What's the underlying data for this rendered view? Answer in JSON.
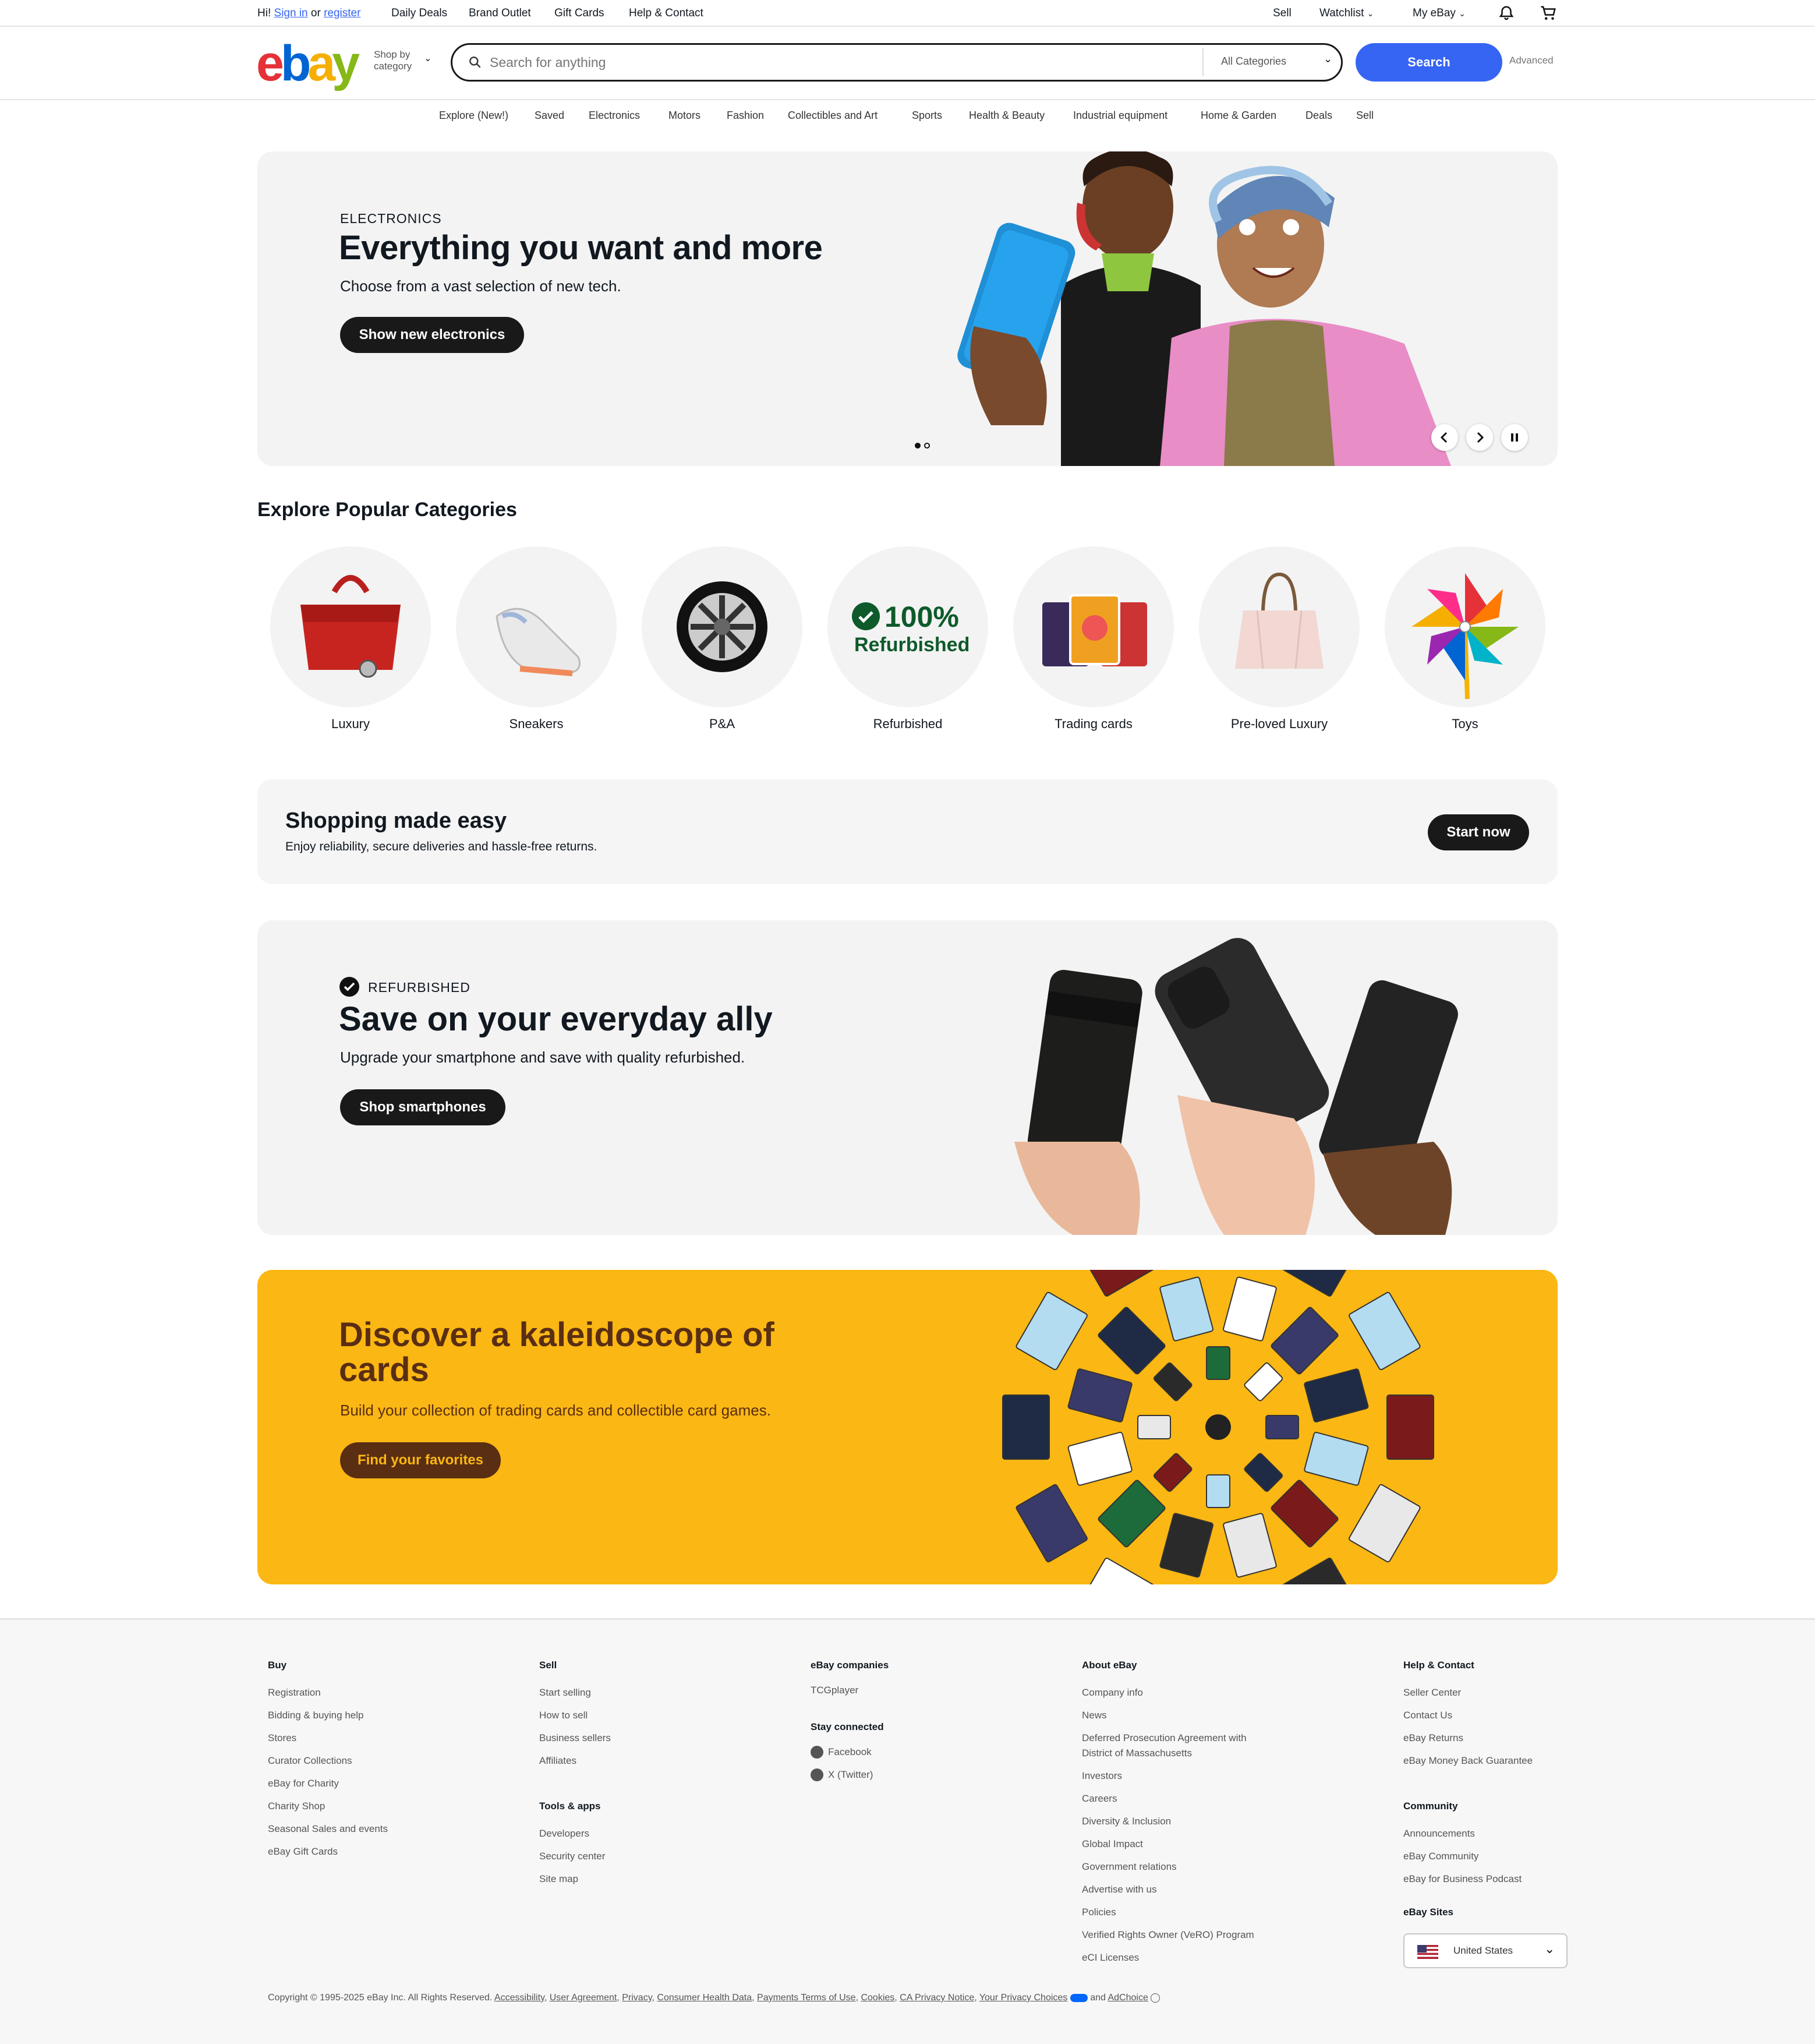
{
  "topbar": {
    "greeting": "Hi!",
    "sign_in": "Sign in",
    "or": "or",
    "register": "register",
    "links": [
      "Daily Deals",
      "Brand Outlet",
      "Gift Cards",
      "Help & Contact"
    ],
    "sell": "Sell",
    "watchlist": "Watchlist",
    "my_ebay": "My eBay"
  },
  "header": {
    "logo_letters": [
      "e",
      "b",
      "a",
      "y"
    ],
    "logo_colors": [
      "#e53238",
      "#0064d2",
      "#f5af02",
      "#86b817"
    ],
    "shop_by_1": "Shop by",
    "shop_by_2": "category",
    "search_placeholder": "Search for anything",
    "category_select": "All Categories",
    "search_button": "Search",
    "advanced": "Advanced",
    "accent": "#3665f3"
  },
  "nav": [
    "Explore (New!)",
    "Saved",
    "Electronics",
    "Motors",
    "Fashion",
    "Collectibles and Art",
    "Sports",
    "Health & Beauty",
    "Industrial equipment",
    "Home & Garden",
    "Deals",
    "Sell"
  ],
  "hero": {
    "eyebrow": "ELECTRONICS",
    "title": "Everything you want and more",
    "subtitle": "Choose from a vast selection of new tech.",
    "cta": "Show new electronics"
  },
  "categories": {
    "heading": "Explore Popular Categories",
    "items": [
      "Luxury",
      "Sneakers",
      "P&A",
      "Refurbished",
      "Trading cards",
      "Pre-loved Luxury",
      "Toys"
    ],
    "refurb_badge_1": "100%",
    "refurb_badge_2": "Refurbished"
  },
  "easy": {
    "title": "Shopping made easy",
    "subtitle": "Enjoy reliability, secure deliveries and hassle-free returns.",
    "cta": "Start now"
  },
  "refurb": {
    "eyebrow": "REFURBISHED",
    "title": "Save on your everyday ally",
    "subtitle": "Upgrade your smartphone and save with quality refurbished.",
    "cta": "Shop smartphones"
  },
  "cards": {
    "title_1": "Discover a kaleidoscope of",
    "title_2": "cards",
    "subtitle": "Build your collection of trading cards and collectible card games.",
    "cta": "Find your favorites",
    "bg": "#fbb713"
  },
  "footer": {
    "buy": {
      "heading": "Buy",
      "links": [
        "Registration",
        "Bidding & buying help",
        "Stores",
        "Curator Collections",
        "eBay for Charity",
        "Charity Shop",
        "Seasonal Sales and events",
        "eBay Gift Cards"
      ]
    },
    "sell": {
      "heading": "Sell",
      "links": [
        "Start selling",
        "How to sell",
        "Business sellers",
        "Affiliates"
      ]
    },
    "tools": {
      "heading": "Tools & apps",
      "links": [
        "Developers",
        "Security center",
        "Site map"
      ]
    },
    "companies": {
      "heading": "eBay companies",
      "links": [
        "TCGplayer"
      ]
    },
    "stay": {
      "heading": "Stay connected",
      "links": [
        "Facebook",
        "X (Twitter)"
      ]
    },
    "about": {
      "heading": "About eBay",
      "links": [
        "Company info",
        "News",
        "Deferred Prosecution Agreement with",
        "District of Massachusetts",
        "Investors",
        "Careers",
        "Diversity & Inclusion",
        "Global Impact",
        "Government relations",
        "Advertise with us",
        "Policies",
        "Verified Rights Owner (VeRO) Program",
        "eCI Licenses"
      ]
    },
    "help": {
      "heading": "Help & Contact",
      "links": [
        "Seller Center",
        "Contact Us",
        "eBay Returns",
        "eBay Money Back Guarantee"
      ]
    },
    "community": {
      "heading": "Community",
      "links": [
        "Announcements",
        "eBay Community",
        "eBay for Business Podcast"
      ]
    },
    "sites": {
      "heading": "eBay Sites",
      "selected": "United States"
    },
    "copyright": "Copyright © 1995-2025 eBay Inc. All Rights Reserved.",
    "legal_links": [
      "Accessibility",
      "User Agreement",
      "Privacy",
      "Consumer Health Data",
      "Payments Terms of Use",
      "Cookies",
      "CA Privacy Notice",
      "Your Privacy Choices"
    ],
    "and": "and",
    "adchoice": "AdChoice"
  }
}
